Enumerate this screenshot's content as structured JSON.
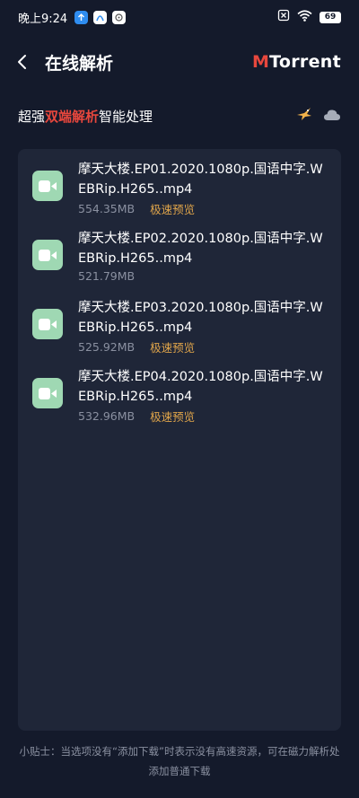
{
  "status_bar": {
    "time": "晚上9:24",
    "battery": "69"
  },
  "header": {
    "title": "在线解析",
    "brand_m": "M",
    "brand_rest": "Torrent"
  },
  "subtitle": {
    "prefix": "超强",
    "highlight": "双端解析",
    "suffix": "智能处理"
  },
  "files": [
    {
      "name": "摩天大楼.EP01.2020.1080p.国语中字.WEBRip.H265..mp4",
      "size": "554.35MB",
      "preview": "极速预览"
    },
    {
      "name": "摩天大楼.EP02.2020.1080p.国语中字.WEBRip.H265..mp4",
      "size": "521.79MB",
      "preview": ""
    },
    {
      "name": "摩天大楼.EP03.2020.1080p.国语中字.WEBRip.H265..mp4",
      "size": "525.92MB",
      "preview": "极速预览"
    },
    {
      "name": "摩天大楼.EP04.2020.1080p.国语中字.WEBRip.H265..mp4",
      "size": "532.96MB",
      "preview": "极速预览"
    }
  ],
  "tip": {
    "line1": "小贴士：当选项没有“添加下载”时表示没有高速资源，可在磁力解析处",
    "line2": "添加普通下载"
  },
  "colors": {
    "background": "#141a2b",
    "panel": "#1f2638",
    "accent_red": "#e8473d",
    "preview_orange": "#e0a54a",
    "thumb_green": "#9fd8b3",
    "muted_text": "#8a90a0"
  },
  "icons": {
    "back": "chevron-left-icon",
    "bird": "bird-icon",
    "cloud": "cloud-icon",
    "file": "video-camera-icon"
  }
}
